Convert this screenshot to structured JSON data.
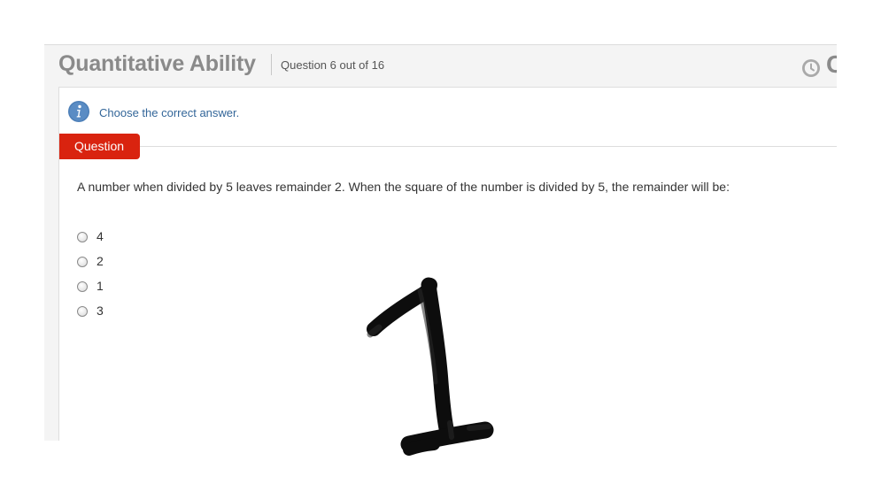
{
  "header": {
    "section_title": "Quantitative Ability",
    "question_counter": "Question 6 out of 16",
    "timer_partial": "C"
  },
  "instruction": "Choose the correct answer.",
  "question_tab": "Question",
  "question": {
    "text": "A number when divided by 5 leaves remainder 2. When the square of the number is divided by 5, the remainder will be:",
    "options": [
      "4",
      "2",
      "1",
      "3"
    ]
  },
  "handwritten_digit": "1",
  "icons": {
    "info": "info-icon",
    "timer": "clock-icon"
  },
  "colors": {
    "accent_red": "#d9230f",
    "link_blue": "#336699",
    "title_gray": "#8a8a8a"
  }
}
